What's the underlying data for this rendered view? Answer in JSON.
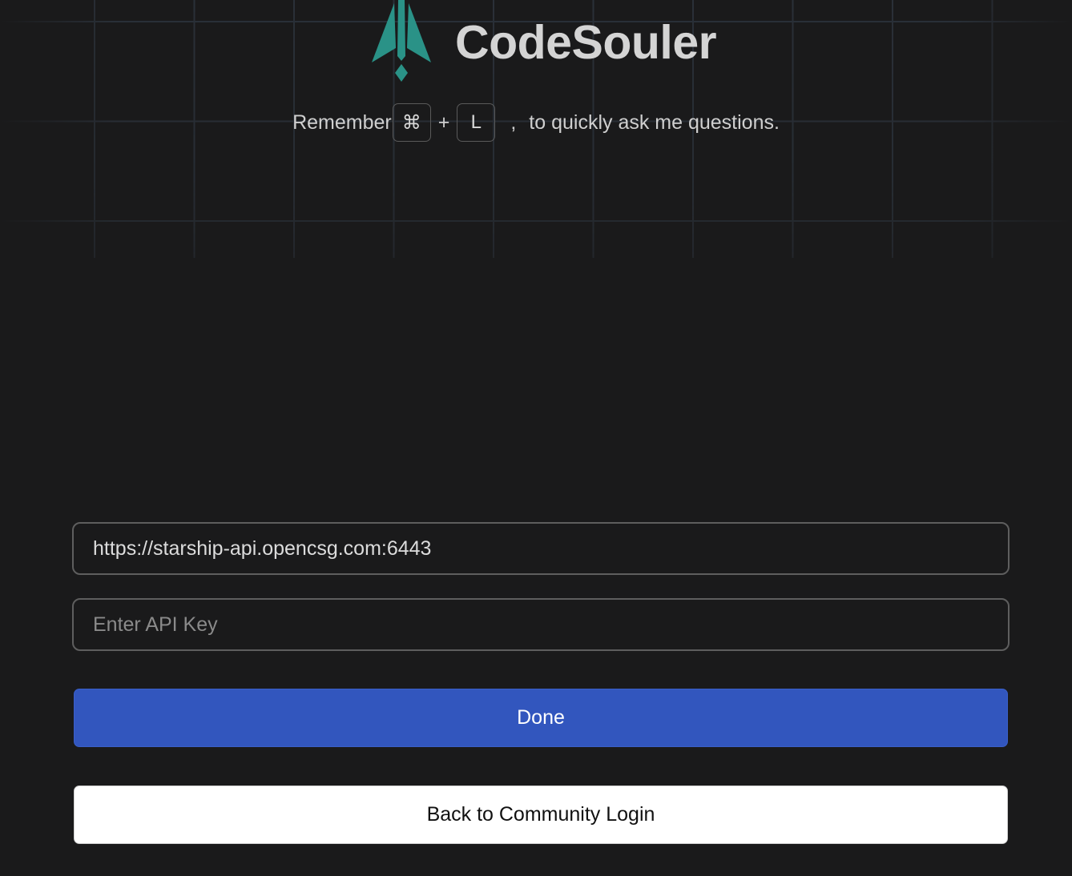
{
  "brand": {
    "name": "CodeSouler",
    "logo_icon": "rocket-logo-icon",
    "logo_color": "#2a9287"
  },
  "hint": {
    "prefix": "Remember",
    "key1": "⌘",
    "plus": "+",
    "key2": "L",
    "separator": ",",
    "suffix": "to quickly ask me questions."
  },
  "form": {
    "url_value": "https://starship-api.opencsg.com:6443",
    "api_key_placeholder": "Enter API Key",
    "api_key_value": ""
  },
  "buttons": {
    "done_label": "Done",
    "back_label": "Back to Community Login"
  },
  "colors": {
    "background": "#1a1a1b",
    "primary": "#3256be",
    "grid": "#2a3038"
  }
}
